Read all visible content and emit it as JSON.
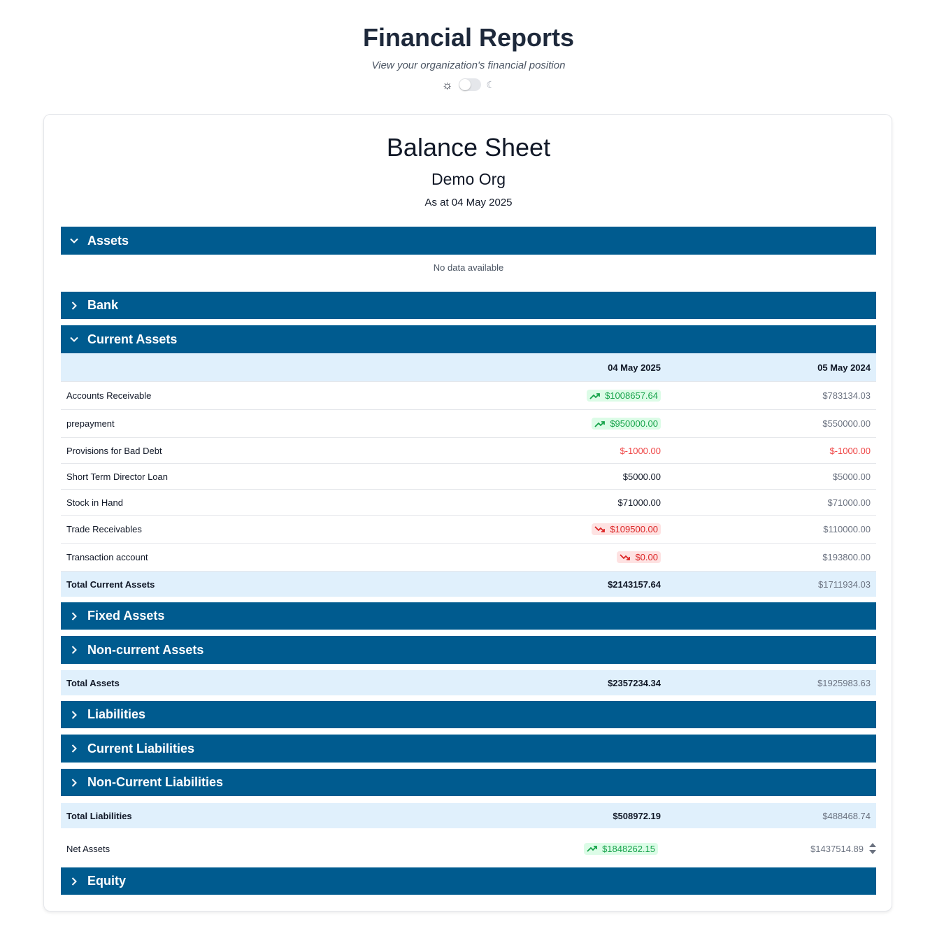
{
  "header": {
    "title": "Financial Reports",
    "subtitle": "View your organization's financial position",
    "theme_light_icon": "sun-icon",
    "theme_dark_icon": "moon-icon"
  },
  "report": {
    "title": "Balance Sheet",
    "org": "Demo Org",
    "as_at": "As at 04 May 2025"
  },
  "sections": {
    "assets": {
      "label": "Assets",
      "expanded": true,
      "empty_text": "No data available"
    },
    "bank": {
      "label": "Bank",
      "expanded": false
    },
    "current_assets": {
      "label": "Current Assets",
      "expanded": true
    },
    "fixed_assets": {
      "label": "Fixed Assets",
      "expanded": false
    },
    "non_current_assets": {
      "label": "Non-current Assets",
      "expanded": false
    },
    "liabilities": {
      "label": "Liabilities",
      "expanded": false
    },
    "current_liabilities": {
      "label": "Current Liabilities",
      "expanded": false
    },
    "non_current_liabilities": {
      "label": "Non-Current Liabilities",
      "expanded": false
    },
    "equity": {
      "label": "Equity",
      "expanded": false
    }
  },
  "columns": {
    "current": "04 May 2025",
    "prior": "05 May 2024"
  },
  "current_assets_rows": [
    {
      "label": "Accounts Receivable",
      "current": "$1008657.64",
      "prior": "$783134.03",
      "trend": "up"
    },
    {
      "label": "prepayment",
      "current": "$950000.00",
      "prior": "$550000.00",
      "trend": "up"
    },
    {
      "label": "Provisions for Bad Debt",
      "current": "$-1000.00",
      "prior": "$-1000.00",
      "trend": "negative"
    },
    {
      "label": "Short Term Director Loan",
      "current": "$5000.00",
      "prior": "$5000.00",
      "trend": "none"
    },
    {
      "label": "Stock in Hand",
      "current": "$71000.00",
      "prior": "$71000.00",
      "trend": "none"
    },
    {
      "label": "Trade Receivables",
      "current": "$109500.00",
      "prior": "$110000.00",
      "trend": "down"
    },
    {
      "label": "Transaction account",
      "current": "$0.00",
      "prior": "$193800.00",
      "trend": "down"
    }
  ],
  "totals": {
    "current_assets": {
      "label": "Total Current Assets",
      "current": "$2143157.64",
      "prior": "$1711934.03"
    },
    "assets": {
      "label": "Total Assets",
      "current": "$2357234.34",
      "prior": "$1925983.63"
    },
    "liabilities": {
      "label": "Total Liabilities",
      "current": "$508972.19",
      "prior": "$488468.74"
    },
    "net_assets": {
      "label": "Net Assets",
      "current": "$1848262.15",
      "prior": "$1437514.89",
      "trend": "up"
    }
  },
  "colors": {
    "section_bg": "#005b8f",
    "header_row_bg": "#e0f0fc",
    "up": "#16a34a",
    "down": "#dc2626",
    "negative": "#ef4444"
  }
}
